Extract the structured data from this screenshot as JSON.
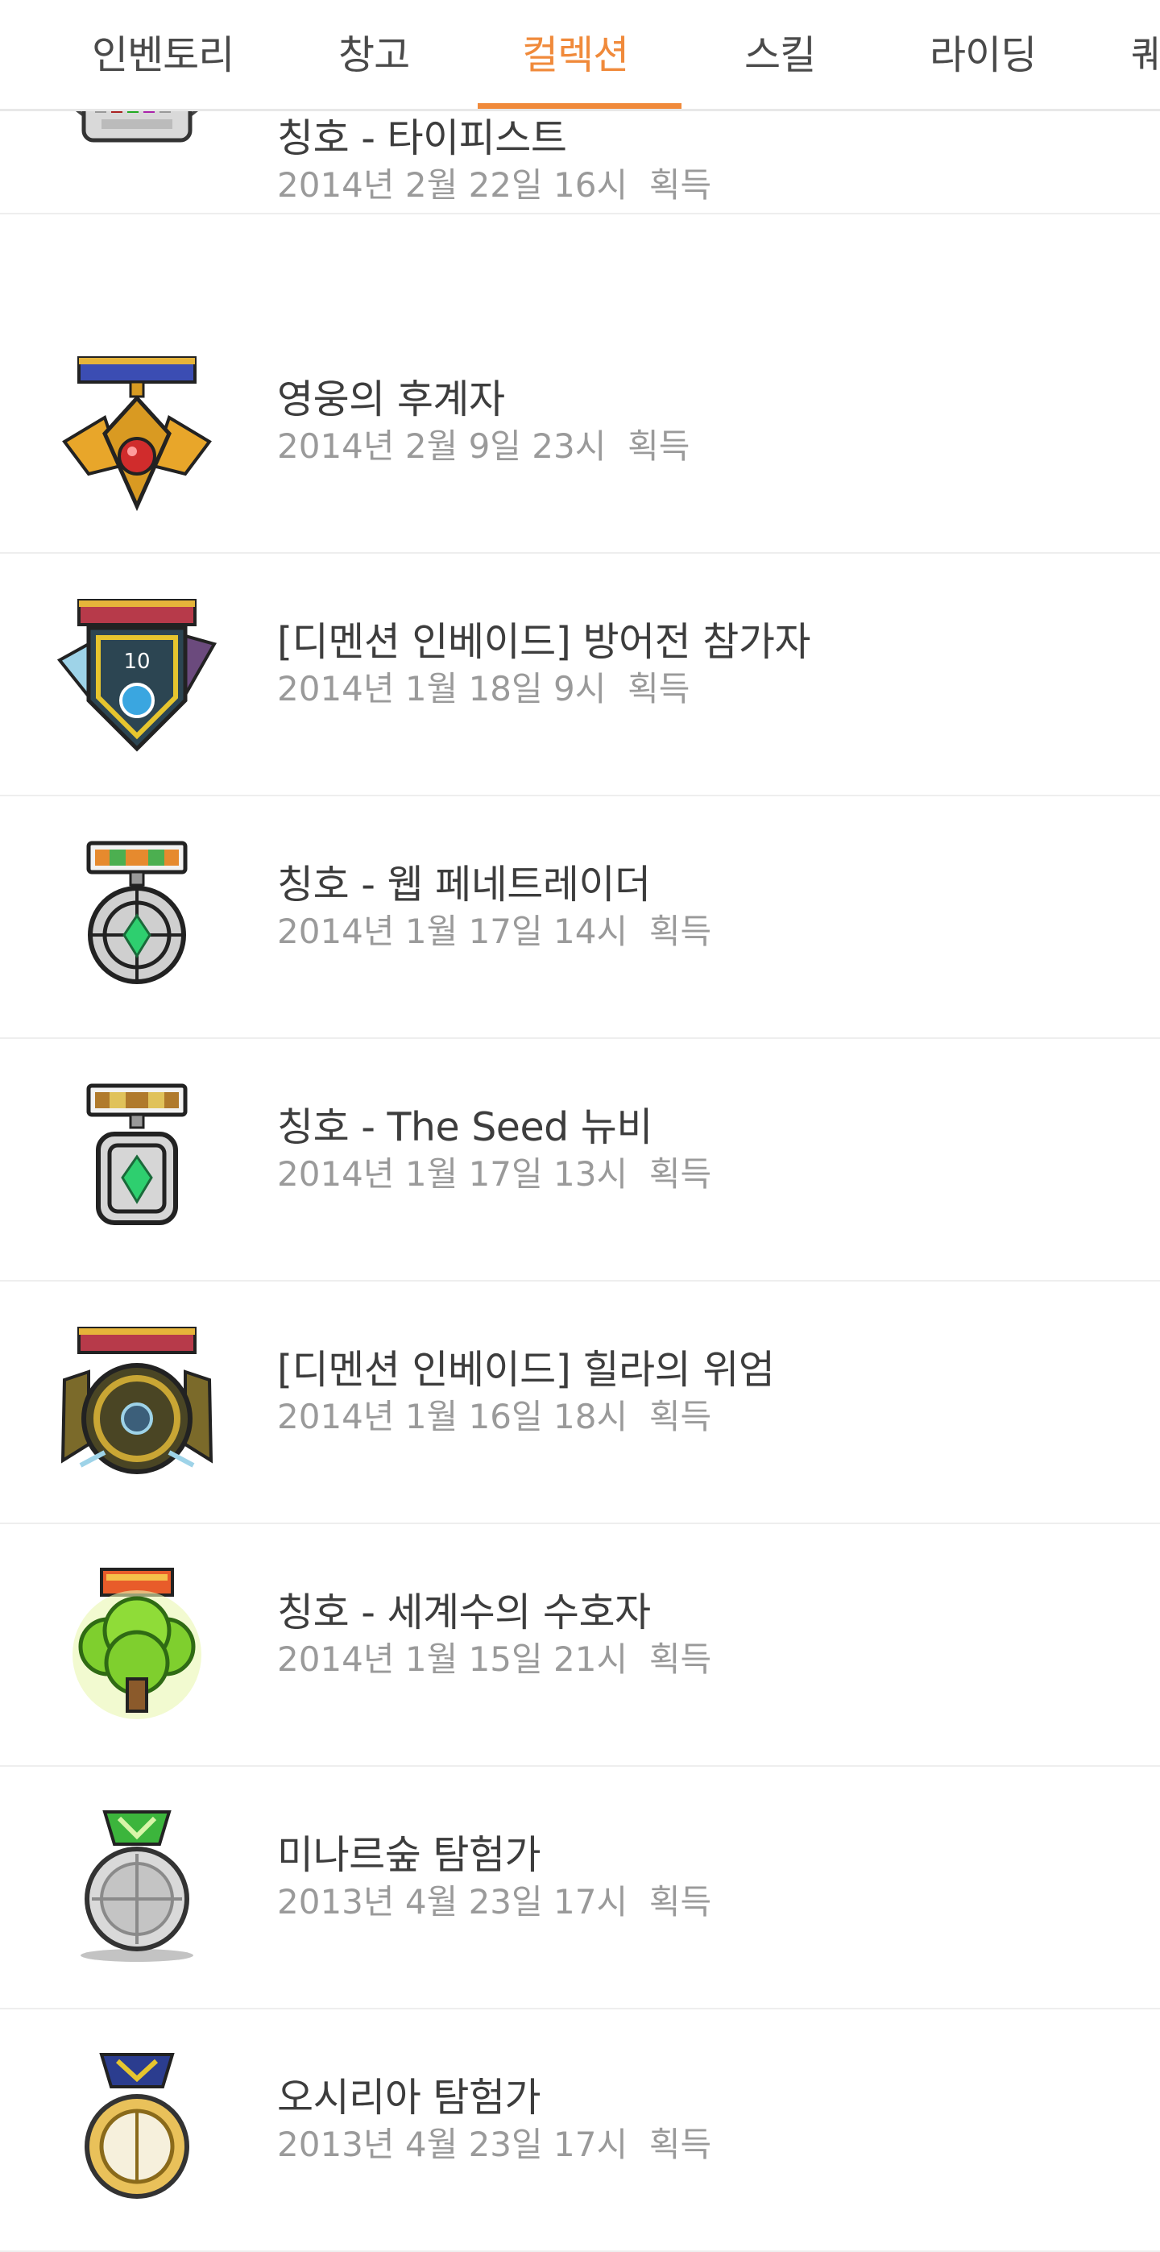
{
  "tabs": [
    {
      "label": "인벤토리",
      "active": false
    },
    {
      "label": "창고",
      "active": false
    },
    {
      "label": "컬렉션",
      "active": true
    },
    {
      "label": "스킬",
      "active": false
    },
    {
      "label": "라이딩",
      "active": false
    },
    {
      "label": "퀘",
      "active": false
    }
  ],
  "accent_color": "#f08a3b",
  "items": [
    {
      "title": "칭호 - 타이피스트",
      "date": "2014년 2월 22일 16시",
      "status": "획득",
      "icon": "typist-medal-icon"
    },
    {
      "title": "영웅의 후계자",
      "date": "2014년 2월 9일 23시",
      "status": "획득",
      "icon": "hero-successor-medal-icon"
    },
    {
      "title": "[디멘션 인베이드] 방어전 참가자",
      "date": "2014년 1월 18일 9시",
      "status": "획득",
      "icon": "dimension-defense-medal-icon"
    },
    {
      "title": "칭호 - 웹 페네트레이더",
      "date": "2014년 1월 17일 14시",
      "status": "획득",
      "icon": "web-penetrator-medal-icon"
    },
    {
      "title": "칭호 - The Seed 뉴비",
      "date": "2014년 1월 17일 13시",
      "status": "획득",
      "icon": "the-seed-newbie-medal-icon"
    },
    {
      "title": "[디멘션 인베이드] 힐라의 위엄",
      "date": "2014년 1월 16일 18시",
      "status": "획득",
      "icon": "hilla-dignity-medal-icon"
    },
    {
      "title": "칭호 - 세계수의 수호자",
      "date": "2014년 1월 15일 21시",
      "status": "획득",
      "icon": "world-tree-guardian-medal-icon"
    },
    {
      "title": "미나르숲 탐험가",
      "date": "2013년 4월 23일 17시",
      "status": "획득",
      "icon": "minar-forest-explorer-medal-icon"
    },
    {
      "title": "오시리아 탐험가",
      "date": "2013년 4월 23일 17시",
      "status": "획득",
      "icon": "ossyria-explorer-medal-icon"
    }
  ]
}
